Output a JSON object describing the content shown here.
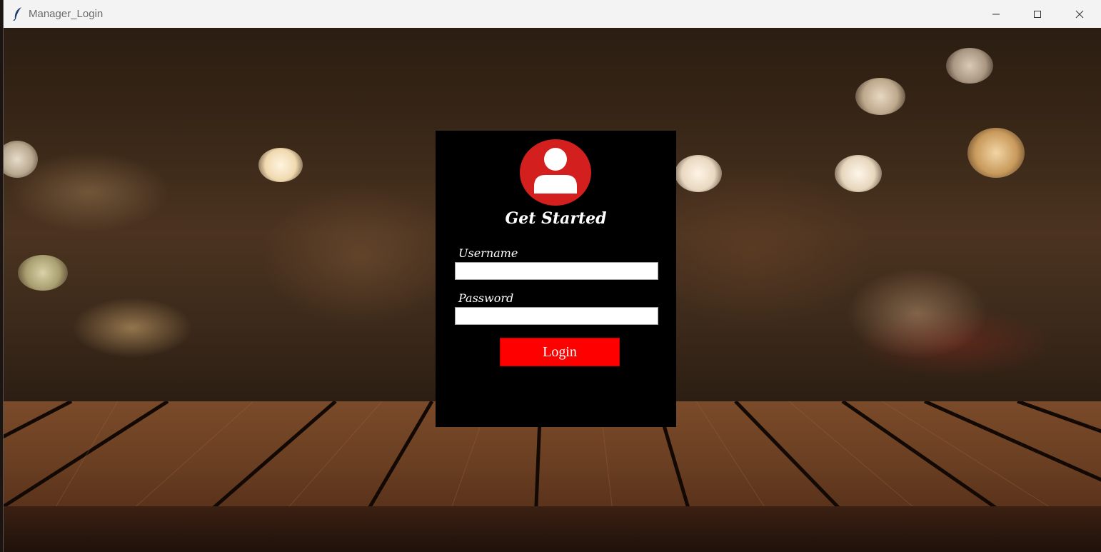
{
  "window": {
    "title": "Manager_Login",
    "app_icon": "feather-icon",
    "controls": {
      "minimize_icon": "minimize-icon",
      "maximize_icon": "maximize-icon",
      "close_icon": "close-icon"
    }
  },
  "login": {
    "avatar_icon": "user-avatar-icon",
    "heading": "Get Started",
    "username_label": "Username",
    "username_value": "",
    "password_label": "Password",
    "password_value": "",
    "login_button": "Login"
  },
  "colors": {
    "panel_bg": "#000000",
    "avatar_red": "#d41f1f",
    "button_red": "#ff0000"
  }
}
